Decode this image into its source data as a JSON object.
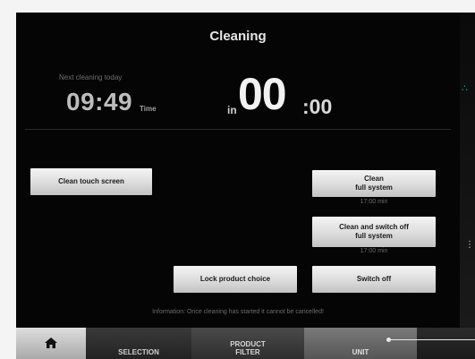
{
  "screen": {
    "title": "Cleaning",
    "next_cleaning_label": "Next cleaning today",
    "clock_time": "09:49",
    "clock_unit": "Time",
    "countdown_prefix": "in",
    "countdown_hours": "00",
    "countdown_minutes": ":00",
    "info": "Information: Once cleaning has started it cannot be cancelled!"
  },
  "buttons": {
    "clean_touch_screen": "Clean touch screen",
    "clean_full_line1": "Clean",
    "clean_full_line2": "full system",
    "clean_full_duration": "17:00 min",
    "clean_switch_line1": "Clean and switch off",
    "clean_switch_line2": "full system",
    "clean_switch_duration": "17:00 min",
    "lock_product_choice": "Lock product choice",
    "switch_off": "Switch off"
  },
  "tabs": {
    "home_icon": "home-icon",
    "selection": "SELECTION",
    "product_line1": "PRODUCT",
    "product_line2": "FILTER",
    "unit": "UNIT"
  },
  "colors": {
    "screen_bg": "#050505",
    "button_face": "#dcdcdc",
    "accent_teal": "#1aa6a0"
  }
}
